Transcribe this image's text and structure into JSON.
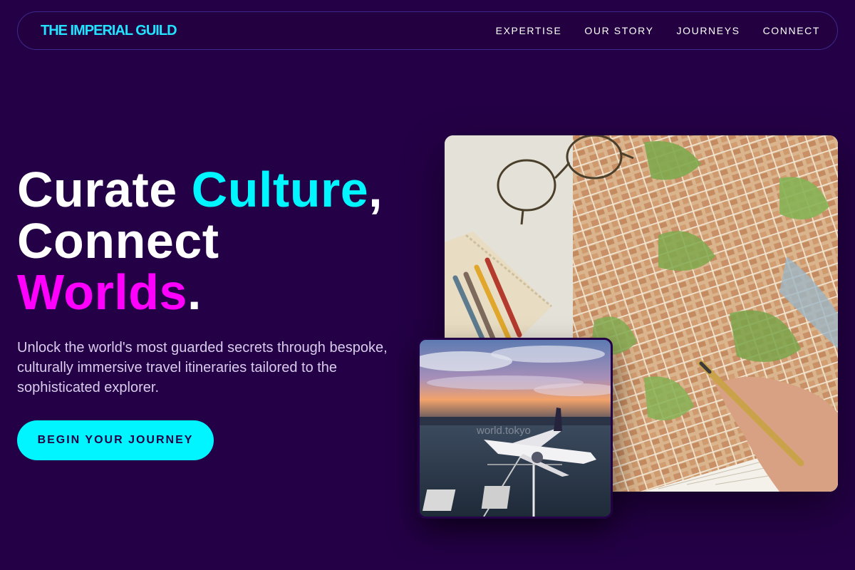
{
  "nav": {
    "logo": "THE IMPERIAL GUILD",
    "links": [
      "EXPERTISE",
      "OUR STORY",
      "JOURNEYS",
      "CONNECT"
    ]
  },
  "hero": {
    "headline_part1": "Curate ",
    "headline_accent1": "Culture",
    "headline_part2": ",",
    "headline_part3": "Connect",
    "headline_accent2": "Worlds",
    "headline_part4": ".",
    "subtext": "Unlock the world's most guarded secrets through bespoke, culturally immersive travel itineraries tailored to the sophisticated explorer.",
    "cta_label": "BEGIN YOUR JOURNEY"
  },
  "images": {
    "map_photo_icon": "map-with-glasses-and-pen-photo",
    "plane_photo_icon": "airplane-at-sunset-photo",
    "plane_watermark": "world.tokyo"
  },
  "colors": {
    "background": "#240046",
    "accent_cyan": "#00f5ff",
    "accent_magenta": "#ff00ff",
    "logo": "#22e3ff"
  }
}
